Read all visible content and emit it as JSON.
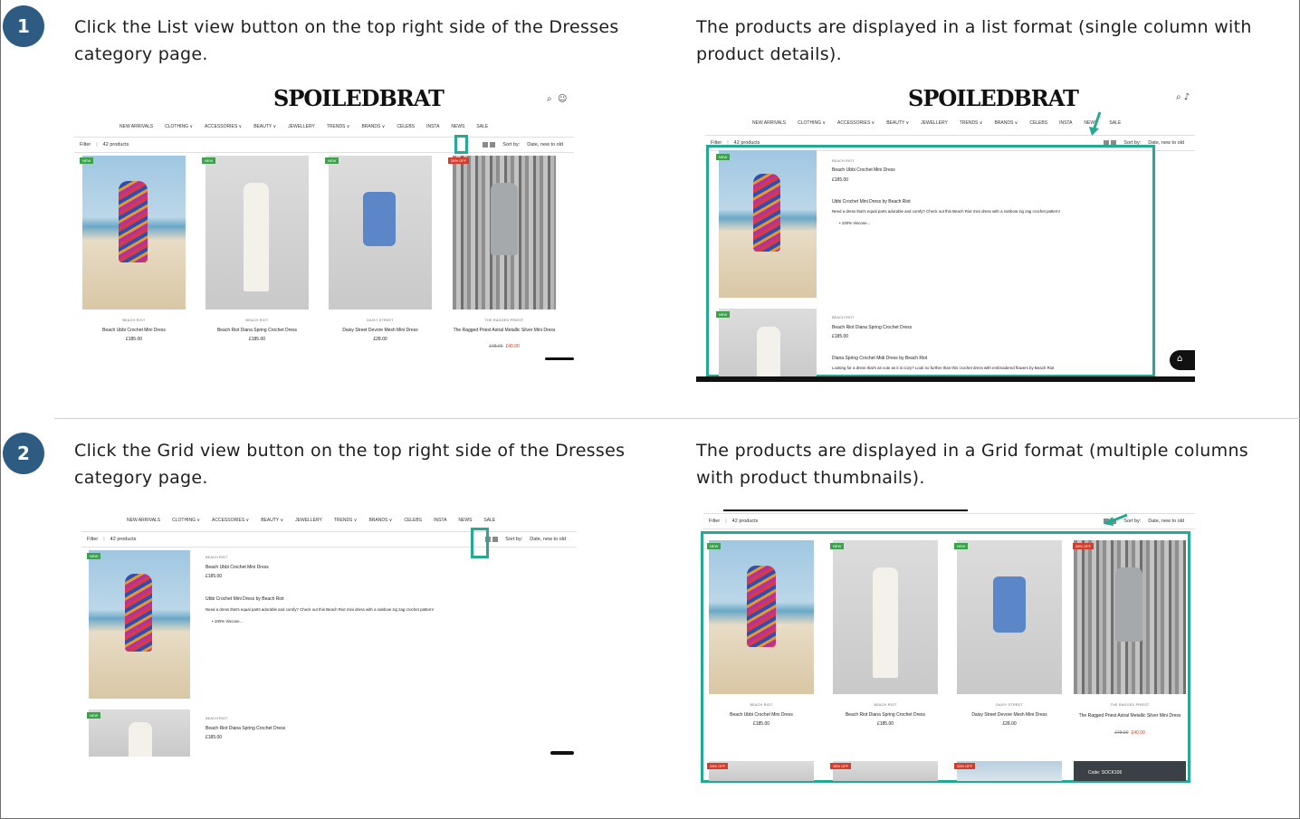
{
  "steps": [
    {
      "number": "1",
      "action": "Click the List view button on the top right side of the Dresses category page.",
      "expected": "The products are displayed in a list format (single column with product details)."
    },
    {
      "number": "2",
      "action": "Click the Grid view button on the top right side of the Dresses category page.",
      "expected": "The products are displayed in a Grid format (multiple columns with product thumbnails)."
    }
  ],
  "shop": {
    "logo": "SPOILEDBRAT",
    "nav": [
      "NEW ARRIVALS",
      "CLOTHING ∨",
      "ACCESSORIES ∨",
      "BEAUTY ∨",
      "JEWELLERY",
      "TRENDS ∨",
      "BRANDS ∨",
      "CELEBS",
      "INSTA",
      "NEWS",
      "SALE"
    ],
    "filter_label": "Filter",
    "product_count": "42 products",
    "sort_label": "Sort by:",
    "sort_value": "Date, new to old",
    "products": [
      {
        "brand": "BEACH RIOT",
        "name": "Beach Ubbi Crochet Mini Dress",
        "price": "£185.00",
        "badge": "NEW"
      },
      {
        "brand": "BEACH RIOT",
        "name": "Beach Riot Diana Spring Crochet Dress",
        "price": "£185.00",
        "badge": "NEW"
      },
      {
        "brand": "DAISY STREET",
        "name": "Daisy Street Devore Mesh Mini Dress",
        "price": "£28.00",
        "badge": "NEW"
      },
      {
        "brand": "THE RAGGED PRIEST",
        "name": "The Ragged Priest Astral Metallic Silver Mini Dress",
        "old_price": "£48.00",
        "price": "£40.00",
        "badge": "28% OFF"
      }
    ],
    "list_details": [
      {
        "brand": "BEACH RIOT",
        "name": "Beach Ubbi Crochet Mini Dress",
        "price": "£185.00",
        "subtitle": "Ubbi Crochet Mini Dress by Beach Riot",
        "desc": "Need a dress that's equal parts adorable and comfy? Check out this Beach Riot mini dress with a rainbow zig zag crochet pattern!",
        "bullet": "100% Viscose..."
      },
      {
        "brand": "BEACH RIOT",
        "name": "Beach Riot Diana Spring Crochet Dress",
        "price": "£185.00",
        "subtitle": "Diana Spring Crochet Midi Dress by Beach Riot",
        "desc": "Looking for a dress that's as cute as it is cozy? Look no further than this crochet dress with embroidered flowers by Beach Riot"
      }
    ],
    "second_row_badges": [
      "28% OFF",
      "28% OFF",
      "28% OFF"
    ],
    "code_banner": "Code: SOCK106"
  }
}
